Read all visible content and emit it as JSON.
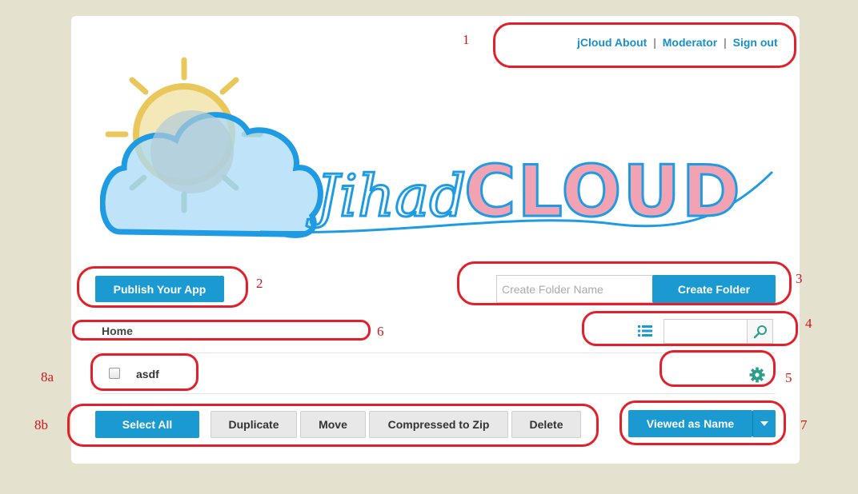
{
  "header": {
    "links": [
      "jCloud About",
      "Moderator",
      "Sign out"
    ],
    "separator": "|"
  },
  "logo": {
    "alt": "JihadCLOUD",
    "script_text": "Jihad",
    "block_text": "CLOUD"
  },
  "actions": {
    "publish_label": "Publish Your App",
    "folder_placeholder": "Create Folder Name",
    "create_folder_label": "Create Folder"
  },
  "breadcrumb": {
    "home": "Home"
  },
  "toolbar": {
    "list_icon": "list-icon",
    "search_icon": "search-icon"
  },
  "files": [
    {
      "name": "asdf",
      "checked": false
    }
  ],
  "settings_icon": "gear-icon",
  "bottom": {
    "buttons": [
      "Select All",
      "Duplicate",
      "Move",
      "Compressed to Zip",
      "Delete"
    ],
    "view_label": "Viewed as Name"
  },
  "annotations": [
    "1",
    "2",
    "3",
    "4",
    "5",
    "6",
    "7",
    "8a",
    "8b"
  ],
  "colors": {
    "accent": "#1a9ad1",
    "annotation": "#e0202a",
    "background": "#e4e2cf",
    "gear": "#2aa08a"
  }
}
